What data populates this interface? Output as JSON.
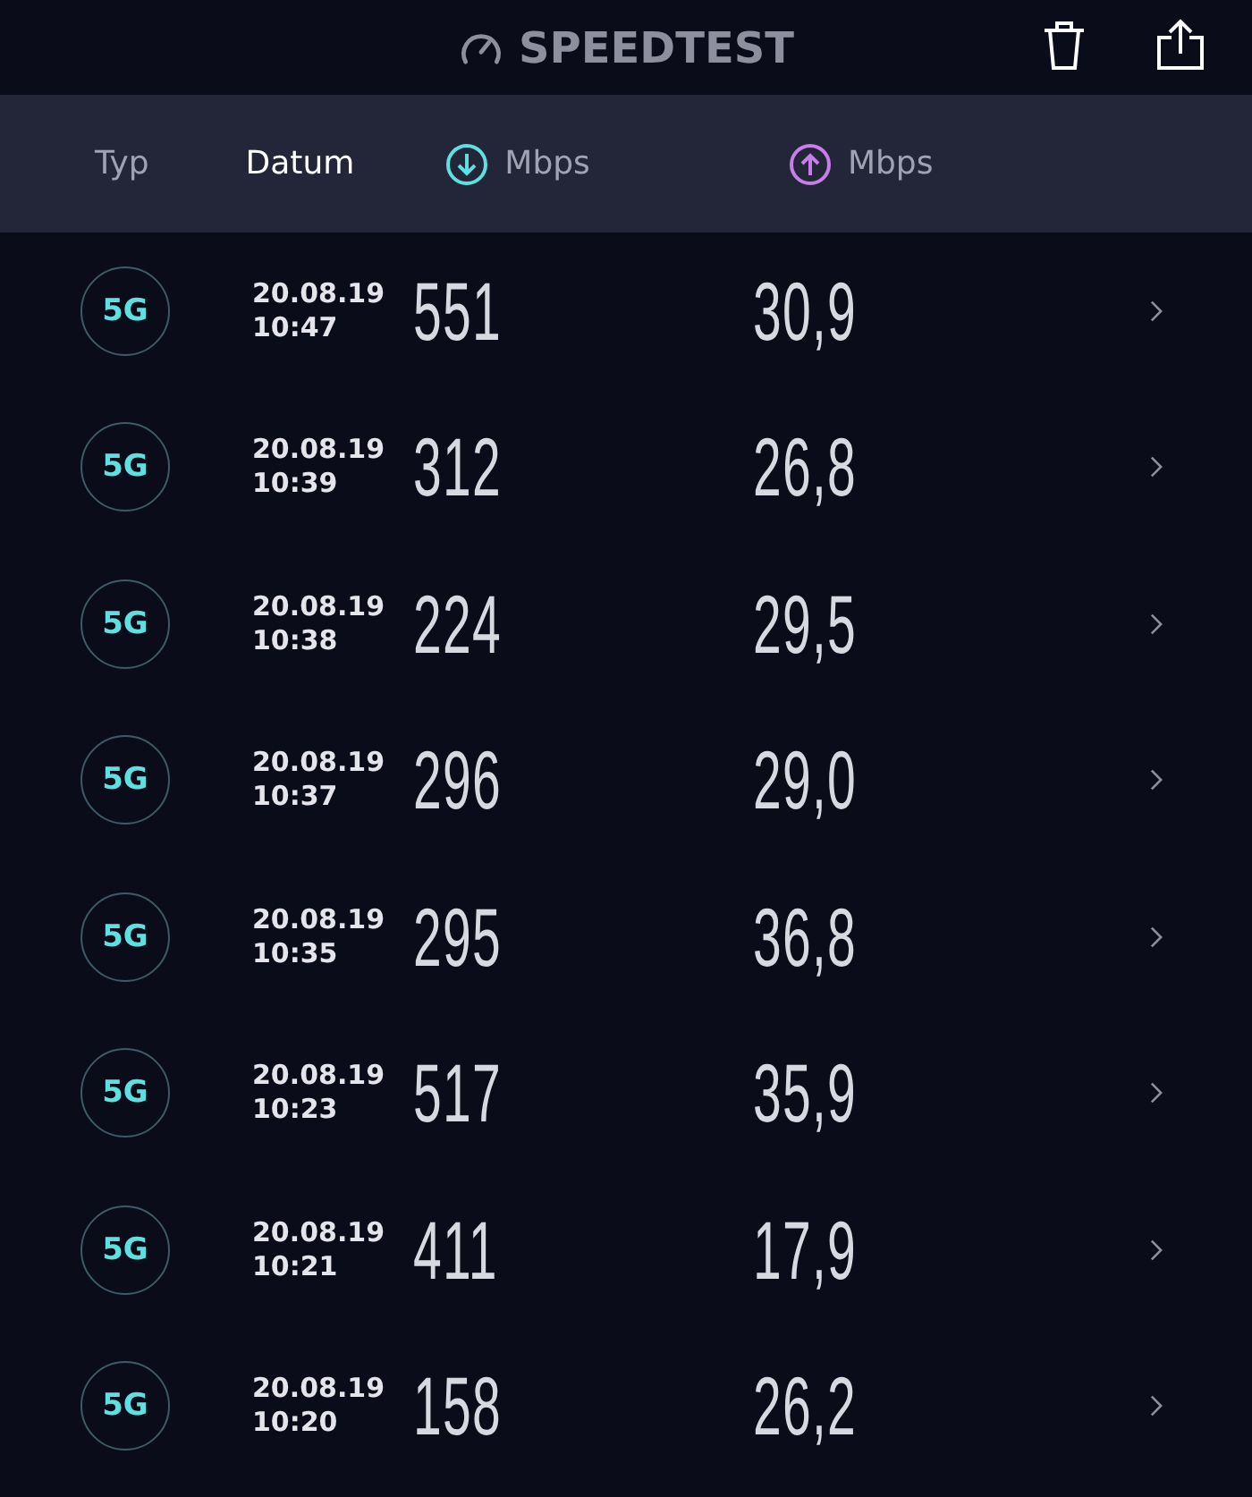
{
  "header": {
    "title": "SPEEDTEST"
  },
  "columns": [
    {
      "label": "Typ",
      "kind": "text",
      "selected": false
    },
    {
      "label": "Datum",
      "kind": "text",
      "selected": true
    },
    {
      "label": "Mbps",
      "kind": "download",
      "selected": false
    },
    {
      "label": "Mbps",
      "kind": "upload",
      "selected": false
    }
  ],
  "rows": [
    {
      "type": "5G",
      "date": "20.08.19",
      "time": "10:47",
      "download": "551",
      "upload": "30,9"
    },
    {
      "type": "5G",
      "date": "20.08.19",
      "time": "10:39",
      "download": "312",
      "upload": "26,8"
    },
    {
      "type": "5G",
      "date": "20.08.19",
      "time": "10:38",
      "download": "224",
      "upload": "29,5"
    },
    {
      "type": "5G",
      "date": "20.08.19",
      "time": "10:37",
      "download": "296",
      "upload": "29,0"
    },
    {
      "type": "5G",
      "date": "20.08.19",
      "time": "10:35",
      "download": "295",
      "upload": "36,8"
    },
    {
      "type": "5G",
      "date": "20.08.19",
      "time": "10:23",
      "download": "517",
      "upload": "35,9"
    },
    {
      "type": "5G",
      "date": "20.08.19",
      "time": "10:21",
      "download": "411",
      "upload": "17,9"
    },
    {
      "type": "5G",
      "date": "20.08.19",
      "time": "10:20",
      "download": "158",
      "upload": "26,2"
    }
  ]
}
